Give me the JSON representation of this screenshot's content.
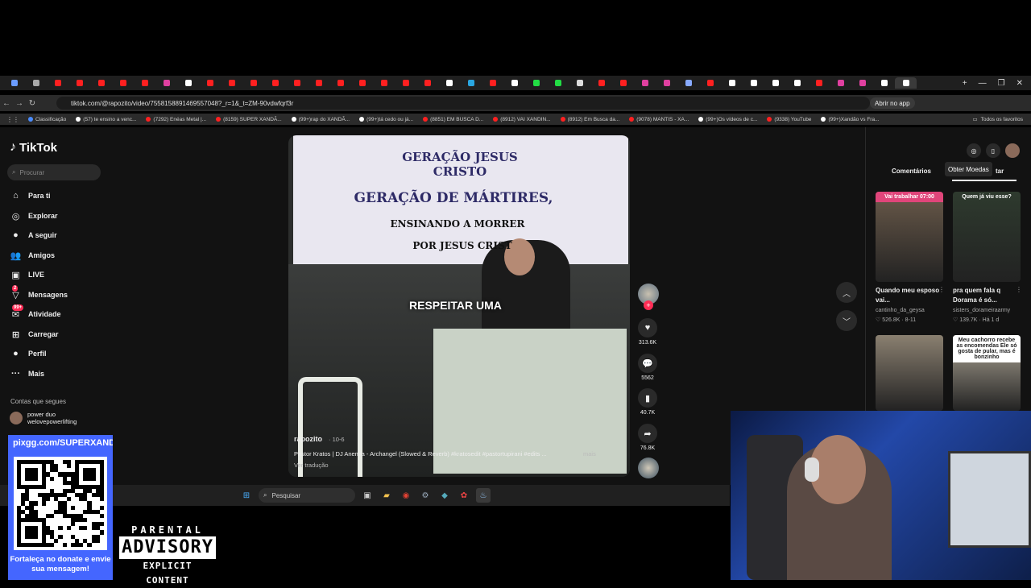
{
  "browser": {
    "tabs_count": 42,
    "url": "tiktok.com/@rapozito/video/7558158891469557048?_r=1&_t=ZM-90vdwfqrf3r",
    "open_app": "Abrir no app",
    "bookmarks": [
      {
        "label": "Classificação",
        "color": "#4a8cff"
      },
      {
        "label": "(57) te ensino a venc...",
        "color": "#ffffff"
      },
      {
        "label": "(7292) Enéas Metal |...",
        "color": "#ff2020"
      },
      {
        "label": "(8159) SUPER XANDÃ...",
        "color": "#ff2020"
      },
      {
        "label": "(99+)rap do XANDÃ...",
        "color": "#ffffff"
      },
      {
        "label": "(99+)tá cedo ou já...",
        "color": "#ffffff"
      },
      {
        "label": "(8851) EM BUSCA D...",
        "color": "#ff2020"
      },
      {
        "label": "(8912) VAI XANDIN...",
        "color": "#ff2020"
      },
      {
        "label": "(8912) Em Busca da...",
        "color": "#ff2020"
      },
      {
        "label": "(9078) MANTIS - XA...",
        "color": "#ff2020"
      },
      {
        "label": "(99+)Os vídeos de c...",
        "color": "#ffffff"
      },
      {
        "label": "(9338) YouTube",
        "color": "#ff2020"
      },
      {
        "label": "(99+)Xandão vs Fra...",
        "color": "#ffffff"
      }
    ],
    "all_favorites": "Todos os favoritos"
  },
  "tiktok": {
    "logo": "TikTok",
    "search_placeholder": "Procurar",
    "nav": [
      {
        "label": "Para ti",
        "icon": "home-icon",
        "glyph": "⌂",
        "badge": ""
      },
      {
        "label": "Explorar",
        "icon": "compass-icon",
        "glyph": "◎",
        "badge": ""
      },
      {
        "label": "A seguir",
        "icon": "avatar-icon",
        "glyph": "●",
        "badge": ""
      },
      {
        "label": "Amigos",
        "icon": "friends-icon",
        "glyph": "👥",
        "badge": ""
      },
      {
        "label": "LIVE",
        "icon": "live-icon",
        "glyph": "▣",
        "badge": ""
      },
      {
        "label": "Mensagens",
        "icon": "messages-icon",
        "glyph": "▽",
        "badge": "2"
      },
      {
        "label": "Atividade",
        "icon": "activity-icon",
        "glyph": "✉",
        "badge": "99+"
      },
      {
        "label": "Carregar",
        "icon": "upload-icon",
        "glyph": "⊞",
        "badge": ""
      },
      {
        "label": "Perfil",
        "icon": "profile-icon",
        "glyph": "●",
        "badge": ""
      },
      {
        "label": "Mais",
        "icon": "more-icon",
        "glyph": "···",
        "badge": ""
      }
    ],
    "following_title": "Contas que segues",
    "following": [
      {
        "name": "power duo",
        "handle": "welovepowerlifting"
      }
    ],
    "video": {
      "banner_line1": "GERAÇÃO JESUS CRISTO",
      "banner_line2": "GERAÇÃO DE MÁRTIRES,",
      "banner_line3": "ENSINANDO A MORRER",
      "banner_line4": "POR JESUS CRIST",
      "caption_overlay": "RESPEITAR UMA",
      "author": "rapozito",
      "date": "· 10-6",
      "description": "Pastor Kratos | DJ Anemia - Archangel (Slowed & Reverb) #kratosedit #pastortupirani #edits ...",
      "more": "mais",
      "translate": "Ver tradução"
    },
    "actions": {
      "likes": "313.6K",
      "comments": "5562",
      "saves": "40.7K",
      "shares": "76.8K"
    },
    "panel": {
      "tooltip": "Obter Moedas",
      "tab_comments": "Comentários",
      "tab_more": "tar",
      "videos": [
        {
          "title": "Quando meu esposo vai...",
          "author": "cantinho_da_geysa",
          "views": "526.8K",
          "date": "8-11",
          "overlay": "Vai trabalhar 07:00",
          "bg": "#6a5a4a"
        },
        {
          "title": "pra quem fala q Dorama é só...",
          "author": "sisters_dorameiraarmy",
          "views": "139.7K",
          "date": "Há 1 d",
          "overlay": "Quem já viu esse?",
          "bg": "#2e3a2e"
        },
        {
          "title": "",
          "author": "",
          "views": "",
          "date": "",
          "overlay": "",
          "bg": "#8a8070"
        },
        {
          "title": "",
          "author": "",
          "views": "",
          "date": "",
          "overlay": "Meu cachorro recebe as encomendas Ele só gosta de pular, mas é bonzinho",
          "bg": "#b0a898"
        }
      ]
    }
  },
  "taskbar": {
    "search": "Pesquisar"
  },
  "overlay": {
    "qr_header": "pixgg.com/SUPERXANDA",
    "qr_footer": "Fortaleça no donate e envie sua mensagem!",
    "advisory_line1": "PARENTAL",
    "advisory_line2": "ADVISORY",
    "advisory_line3": "EXPLICIT CONTENT"
  },
  "colors": {
    "accent": "#fe2c55",
    "qr_bg": "#4466ff",
    "page_bg": "#121212"
  }
}
